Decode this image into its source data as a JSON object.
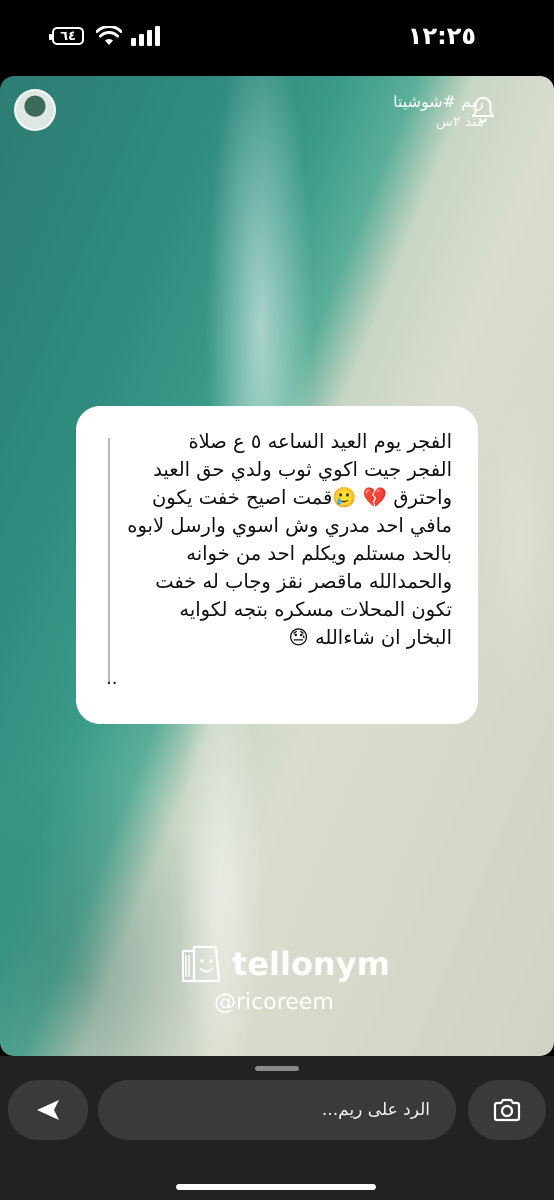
{
  "status_bar": {
    "time": "١٢:٢٥",
    "battery": "٦٤"
  },
  "story": {
    "user_name": "ريم #شوشيتا",
    "post_time": "منذ ٢س",
    "question_lines": [
      "الفجر يوم العيد الساعه ٥ ع صلاة",
      "الفجر جيت اكوي ثوب ولدي حق العيد",
      "واحترق 💔 🥲قمت اصيح خفت يكون",
      "مافي احد مدري وش اسوي وارسل لابوه",
      "بالحد مستلم ويكلم احد من خوانه",
      "والحمدالله ماقصر نقز وجاب له خفت",
      "تكون المحلات مسكره بتجه لكوايه",
      "البخار ان شاءالله 😓"
    ],
    "answer": "..",
    "brand_name": "tellonym",
    "brand_handle": "@ricoreem"
  },
  "reply": {
    "placeholder": "الرد على ريم..."
  },
  "icons": {
    "bell": "bell-icon",
    "send": "send-arrow-icon",
    "camera": "camera-icon",
    "brand": "tellonym-logo-icon"
  }
}
